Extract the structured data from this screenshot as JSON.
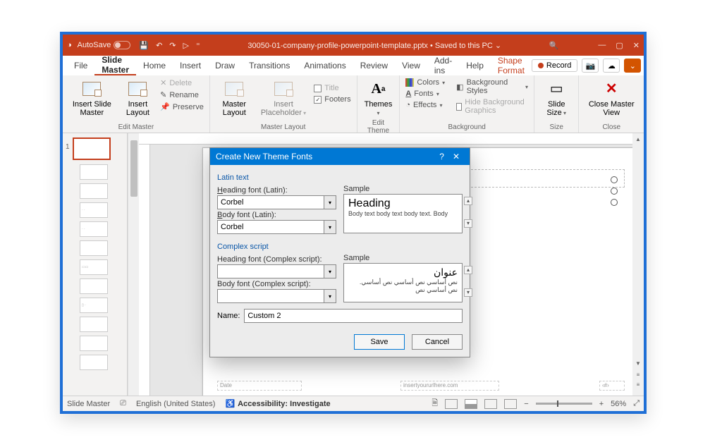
{
  "titlebar": {
    "autosave_label": "AutoSave",
    "title": "30050-01-company-profile-powerpoint-template.pptx • Saved to this PC ⌄"
  },
  "tabs": {
    "file": "File",
    "slide_master": "Slide Master",
    "home": "Home",
    "insert": "Insert",
    "draw": "Draw",
    "transitions": "Transitions",
    "animations": "Animations",
    "review": "Review",
    "view": "View",
    "addins": "Add-ins",
    "help": "Help",
    "shape_format": "Shape Format",
    "record": "Record"
  },
  "ribbon": {
    "insert_slide_master": "Insert Slide Master",
    "insert_layout": "Insert Layout",
    "delete": "Delete",
    "rename": "Rename",
    "preserve": "Preserve",
    "edit_master_group": "Edit Master",
    "master_layout": "Master Layout",
    "insert_placeholder": "Insert Placeholder",
    "title_chk": "Title",
    "footers_chk": "Footers",
    "master_layout_group": "Master Layout",
    "themes": "Themes",
    "colors": "Colors",
    "fonts": "Fonts",
    "effects": "Effects",
    "bg_styles": "Background Styles",
    "hide_bg": "Hide Background Graphics",
    "edit_theme_group": "Edit Theme",
    "background_group": "Background",
    "slide_size": "Slide Size",
    "size_group": "Size",
    "close_master": "Close Master View",
    "close_group": "Close"
  },
  "thumbs": {
    "num1": "1"
  },
  "slide": {
    "date_ph": "Date",
    "url_ph": "insertyoururlhere.com",
    "pagenum_ph": "‹#›"
  },
  "dialog": {
    "title": "Create New Theme Fonts",
    "latin_text": "Latin text",
    "heading_latin_label": "Heading font (Latin):",
    "heading_latin_value": "Corbel",
    "body_latin_label": "Body font (Latin):",
    "body_latin_value": "Corbel",
    "sample_label": "Sample",
    "sample_heading": "Heading",
    "sample_body": "Body text body text body text. Body",
    "complex_script": "Complex script",
    "heading_cs_label": "Heading font (Complex script):",
    "heading_cs_value": "",
    "body_cs_label": "Body font (Complex script):",
    "body_cs_value": "",
    "sample_cs_heading": "عنوان",
    "sample_cs_body": "نص أساسي نص أساسي نص أساسي. نص أساسي نص",
    "name_label": "Name:",
    "name_value": "Custom 2",
    "save": "Save",
    "cancel": "Cancel"
  },
  "statusbar": {
    "view_name": "Slide Master",
    "language": "English (United States)",
    "accessibility": "Accessibility: Investigate",
    "zoom": "56%"
  }
}
